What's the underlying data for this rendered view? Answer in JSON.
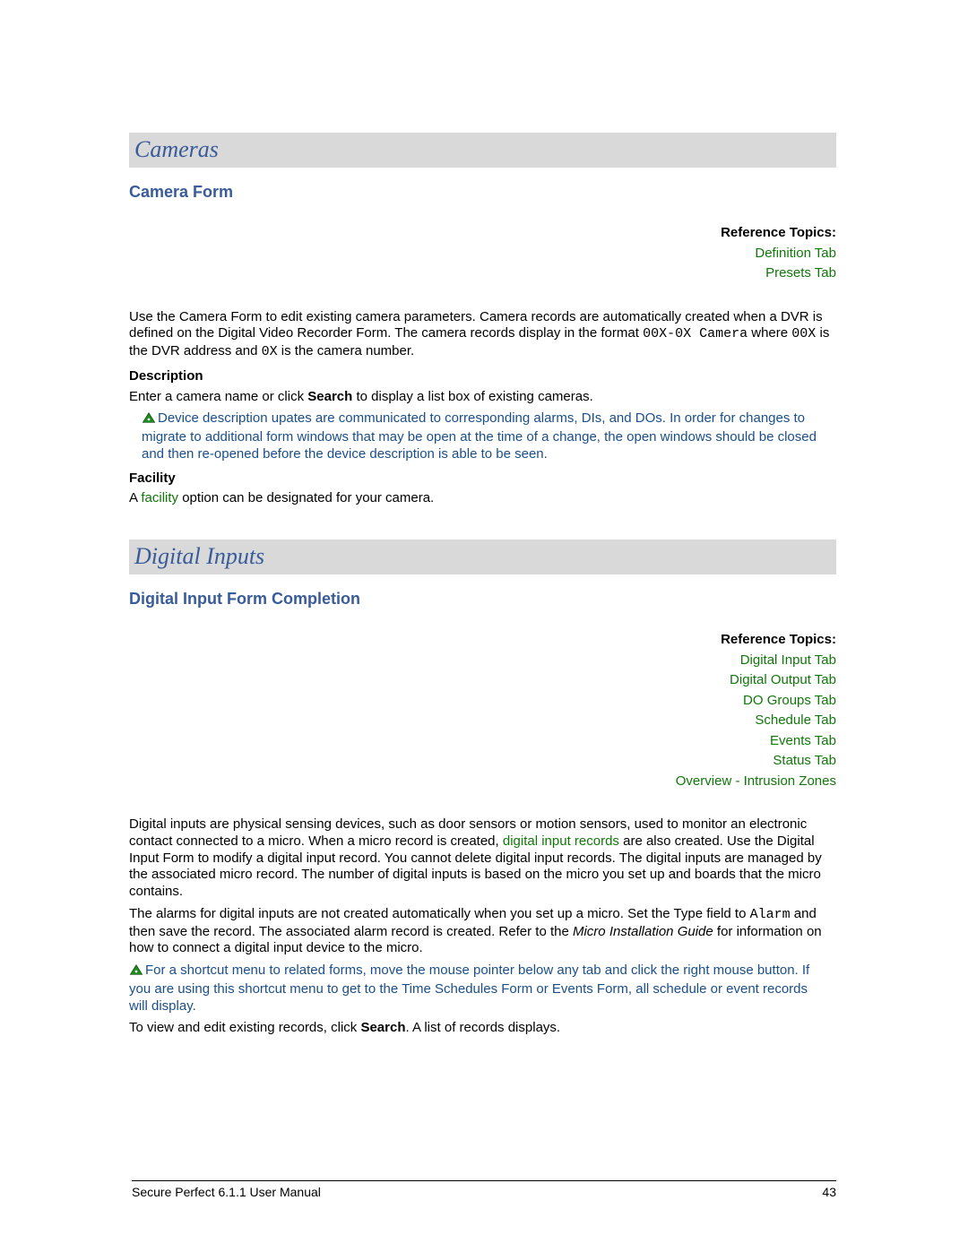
{
  "section1": {
    "title": "Cameras",
    "sub": "Camera Form",
    "ref_label": "Reference Topics:",
    "refs": [
      "Definition Tab",
      "Presets Tab"
    ],
    "p1a": "Use the Camera Form to edit existing camera parameters. Camera records are automatically created when a DVR is defined on the Digital Video Recorder Form. The camera records display in the format ",
    "p1_mono1": "00X-0X Camera",
    "p1b": " where ",
    "p1_mono2": "00X",
    "p1c": " is the DVR address and ",
    "p1_mono3": "0X",
    "p1d": " is the camera number.",
    "desc_label": "Description",
    "desc_text_a": "Enter a camera name or click ",
    "desc_text_bold": "Search",
    "desc_text_b": " to display a list box of existing cameras.",
    "note": "Device description upates are communicated to corresponding alarms, DIs, and DOs. In order for changes to migrate to additional form windows that may be open at the time of a change, the open windows should be closed and then re-opened before the device description is able to be seen.",
    "fac_label": "Facility",
    "fac_a": "A ",
    "fac_link": "facility",
    "fac_b": " option can be designated for your camera."
  },
  "section2": {
    "title": "Digital Inputs",
    "sub": "Digital Input Form Completion",
    "ref_label": "Reference Topics:",
    "refs": [
      "Digital Input Tab",
      "Digital Output Tab",
      "DO Groups Tab",
      "Schedule Tab",
      "Events Tab",
      "Status Tab",
      "Overview - Intrusion Zones"
    ],
    "p1a": "Digital inputs are physical sensing devices, such as door sensors or motion sensors, used to monitor an electronic contact connected to a micro. When a micro record is created, ",
    "p1_link": "digital input records",
    "p1b": " are also created. Use the Digital Input Form to modify a digital input record. You cannot delete digital input records. The digital inputs are managed by the associated micro record. The number of digital inputs is based on the micro you set up and boards that the micro contains.",
    "p2a": "The alarms for digital inputs are not created automatically when you set up a micro. Set the Type field to ",
    "p2_mono": "Alarm",
    "p2b": " and then save the record. The associated alarm record is created. Refer to the ",
    "p2_ital": "Micro Installation Guide",
    "p2c": " for information on how to connect a digital input device to the micro.",
    "note": "For a shortcut menu to related forms, move the mouse pointer below any tab and click the right mouse button. If you are using this shortcut menu to get to the Time Schedules Form or Events Form, all schedule or event records will display.",
    "p3a": "To view and edit existing records, click ",
    "p3_bold": "Search",
    "p3b": ". A list of records displays."
  },
  "footer": {
    "left": "Secure Perfect 6.1.1 User Manual",
    "right": "43"
  }
}
